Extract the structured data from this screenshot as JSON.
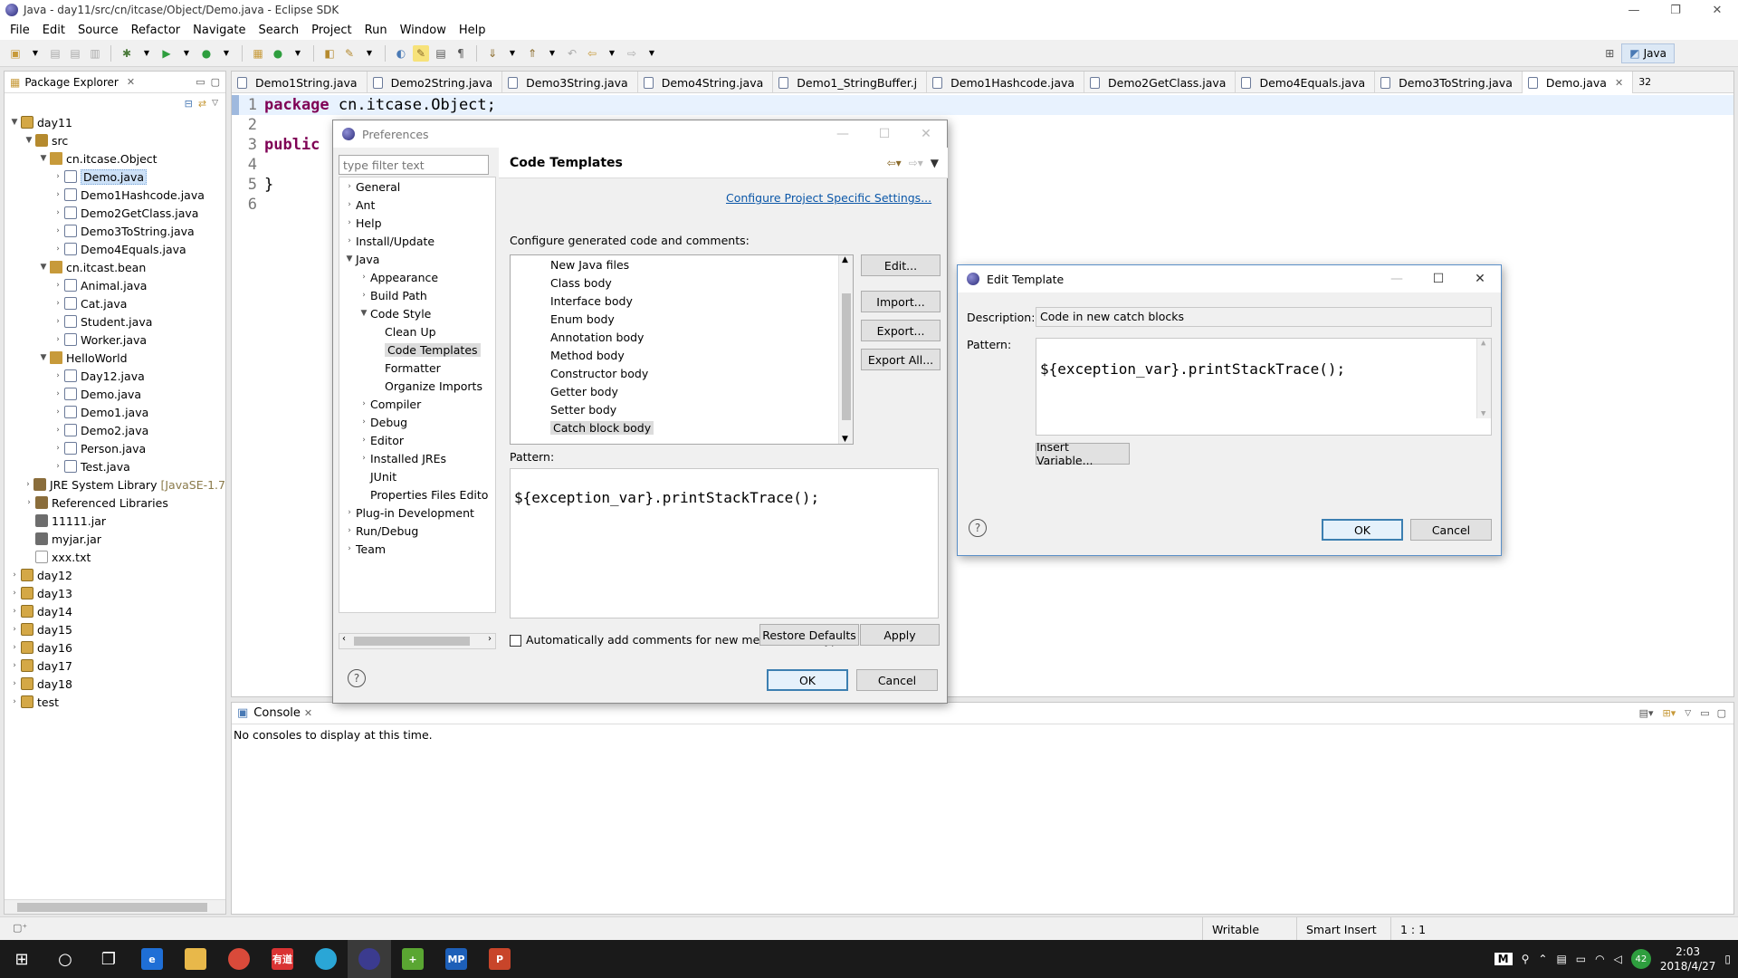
{
  "window": {
    "title": "Java - day11/src/cn/itcase/Object/Demo.java - Eclipse SDK",
    "minimize": "—",
    "restore": "❐",
    "close": "✕"
  },
  "menu": [
    "File",
    "Edit",
    "Source",
    "Refactor",
    "Navigate",
    "Search",
    "Project",
    "Run",
    "Window",
    "Help"
  ],
  "perspective": {
    "label": "Java"
  },
  "package_explorer": {
    "title": "Package Explorer",
    "tree": [
      {
        "label": "day11",
        "depth": 0,
        "icon": "proj",
        "twisty": "▼"
      },
      {
        "label": "src",
        "depth": 1,
        "icon": "src",
        "twisty": "▼"
      },
      {
        "label": "cn.itcase.Object",
        "depth": 2,
        "icon": "pkg",
        "twisty": "▼"
      },
      {
        "label": "Demo.java",
        "depth": 3,
        "icon": "java",
        "twisty": "›",
        "selected": true
      },
      {
        "label": "Demo1Hashcode.java",
        "depth": 3,
        "icon": "java",
        "twisty": "›"
      },
      {
        "label": "Demo2GetClass.java",
        "depth": 3,
        "icon": "java",
        "twisty": "›"
      },
      {
        "label": "Demo3ToString.java",
        "depth": 3,
        "icon": "java",
        "twisty": "›"
      },
      {
        "label": "Demo4Equals.java",
        "depth": 3,
        "icon": "java",
        "twisty": "›"
      },
      {
        "label": "cn.itcast.bean",
        "depth": 2,
        "icon": "pkg",
        "twisty": "▼"
      },
      {
        "label": "Animal.java",
        "depth": 3,
        "icon": "java",
        "twisty": "›"
      },
      {
        "label": "Cat.java",
        "depth": 3,
        "icon": "java",
        "twisty": "›"
      },
      {
        "label": "Student.java",
        "depth": 3,
        "icon": "java",
        "twisty": "›"
      },
      {
        "label": "Worker.java",
        "depth": 3,
        "icon": "java",
        "twisty": "›"
      },
      {
        "label": "HelloWorld",
        "depth": 2,
        "icon": "pkg",
        "twisty": "▼"
      },
      {
        "label": "Day12.java",
        "depth": 3,
        "icon": "java",
        "twisty": "›"
      },
      {
        "label": "Demo.java",
        "depth": 3,
        "icon": "java",
        "twisty": "›"
      },
      {
        "label": "Demo1.java",
        "depth": 3,
        "icon": "java",
        "twisty": "›"
      },
      {
        "label": "Demo2.java",
        "depth": 3,
        "icon": "java",
        "twisty": "›"
      },
      {
        "label": "Person.java",
        "depth": 3,
        "icon": "java",
        "twisty": "›"
      },
      {
        "label": "Test.java",
        "depth": 3,
        "icon": "java",
        "twisty": "›"
      },
      {
        "label": "JRE System Library",
        "extra": "[JavaSE-1.7",
        "depth": 1,
        "icon": "lib",
        "twisty": "›"
      },
      {
        "label": "Referenced Libraries",
        "depth": 1,
        "icon": "lib",
        "twisty": "›"
      },
      {
        "label": "11111.jar",
        "depth": 1,
        "icon": "jar",
        "twisty": ""
      },
      {
        "label": "myjar.jar",
        "depth": 1,
        "icon": "jar",
        "twisty": ""
      },
      {
        "label": "xxx.txt",
        "depth": 1,
        "icon": "txt",
        "twisty": ""
      },
      {
        "label": "day12",
        "depth": 0,
        "icon": "proj",
        "twisty": "›"
      },
      {
        "label": "day13",
        "depth": 0,
        "icon": "proj",
        "twisty": "›"
      },
      {
        "label": "day14",
        "depth": 0,
        "icon": "proj",
        "twisty": "›"
      },
      {
        "label": "day15",
        "depth": 0,
        "icon": "proj",
        "twisty": "›"
      },
      {
        "label": "day16",
        "depth": 0,
        "icon": "proj",
        "twisty": "›"
      },
      {
        "label": "day17",
        "depth": 0,
        "icon": "proj",
        "twisty": "›"
      },
      {
        "label": "day18",
        "depth": 0,
        "icon": "proj",
        "twisty": "›"
      },
      {
        "label": "test",
        "depth": 0,
        "icon": "proj",
        "twisty": "›"
      }
    ]
  },
  "editor": {
    "tabs": [
      {
        "label": "Demo1String.java"
      },
      {
        "label": "Demo2String.java"
      },
      {
        "label": "Demo3String.java"
      },
      {
        "label": "Demo4String.java"
      },
      {
        "label": "Demo1_StringBuffer.j"
      },
      {
        "label": "Demo1Hashcode.java"
      },
      {
        "label": "Demo2GetClass.java"
      },
      {
        "label": "Demo4Equals.java"
      },
      {
        "label": "Demo3ToString.java"
      },
      {
        "label": "Demo.java",
        "active": true
      }
    ],
    "overflow_count": "32",
    "lines": [
      {
        "n": "1",
        "kw": "package",
        "text": " cn.itcase.Object;",
        "current": true
      },
      {
        "n": "2",
        "kw": "",
        "text": ""
      },
      {
        "n": "3",
        "kw": "public",
        "text": ""
      },
      {
        "n": "4",
        "kw": "",
        "text": ""
      },
      {
        "n": "5",
        "kw": "",
        "text": "}"
      },
      {
        "n": "6",
        "kw": "",
        "text": ""
      }
    ]
  },
  "console": {
    "title": "Console",
    "message": "No consoles to display at this time."
  },
  "statusbar": {
    "mode": "Writable",
    "insert": "Smart Insert",
    "position": "1 : 1"
  },
  "preferences": {
    "title": "Preferences",
    "filter_placeholder": "type filter text",
    "tree": [
      {
        "label": "General",
        "depth": 0,
        "twisty": "›"
      },
      {
        "label": "Ant",
        "depth": 0,
        "twisty": "›"
      },
      {
        "label": "Help",
        "depth": 0,
        "twisty": "›"
      },
      {
        "label": "Install/Update",
        "depth": 0,
        "twisty": "›"
      },
      {
        "label": "Java",
        "depth": 0,
        "twisty": "▼"
      },
      {
        "label": "Appearance",
        "depth": 1,
        "twisty": "›"
      },
      {
        "label": "Build Path",
        "depth": 1,
        "twisty": "›"
      },
      {
        "label": "Code Style",
        "depth": 1,
        "twisty": "▼"
      },
      {
        "label": "Clean Up",
        "depth": 2,
        "twisty": ""
      },
      {
        "label": "Code Templates",
        "depth": 2,
        "twisty": "",
        "selected": true
      },
      {
        "label": "Formatter",
        "depth": 2,
        "twisty": ""
      },
      {
        "label": "Organize Imports",
        "depth": 2,
        "twisty": ""
      },
      {
        "label": "Compiler",
        "depth": 1,
        "twisty": "›"
      },
      {
        "label": "Debug",
        "depth": 1,
        "twisty": "›"
      },
      {
        "label": "Editor",
        "depth": 1,
        "twisty": "›"
      },
      {
        "label": "Installed JREs",
        "depth": 1,
        "twisty": "›"
      },
      {
        "label": "JUnit",
        "depth": 1,
        "twisty": ""
      },
      {
        "label": "Properties Files Edito",
        "depth": 1,
        "twisty": ""
      },
      {
        "label": "Plug-in Development",
        "depth": 0,
        "twisty": "›"
      },
      {
        "label": "Run/Debug",
        "depth": 0,
        "twisty": "›"
      },
      {
        "label": "Team",
        "depth": 0,
        "twisty": "›"
      }
    ],
    "page_title": "Code Templates",
    "project_settings_link": "Configure Project Specific Settings...",
    "configure_label": "Configure generated code and comments:",
    "templates": [
      {
        "label": "New Java files"
      },
      {
        "label": "Class body"
      },
      {
        "label": "Interface body"
      },
      {
        "label": "Enum body"
      },
      {
        "label": "Annotation body"
      },
      {
        "label": "Method body"
      },
      {
        "label": "Constructor body"
      },
      {
        "label": "Getter body"
      },
      {
        "label": "Setter body"
      },
      {
        "label": "Catch block body",
        "selected": true
      }
    ],
    "buttons": {
      "edit": "Edit...",
      "import": "Import...",
      "export": "Export...",
      "export_all": "Export All...",
      "restore": "Restore Defaults",
      "apply": "Apply",
      "ok": "OK",
      "cancel": "Cancel"
    },
    "pattern_label": "Pattern:",
    "pattern": "${exception_var}.printStackTrace();",
    "auto_comments_label": "Automatically add comments for new methods and types",
    "help": "?"
  },
  "edit_template": {
    "title": "Edit Template",
    "description_label": "Description:",
    "description": "Code in new catch blocks",
    "pattern_label": "Pattern:",
    "pattern": "${exception_var}.printStackTrace();",
    "insert_variable": "Insert Variable...",
    "ok": "OK",
    "cancel": "Cancel",
    "help": "?"
  },
  "taskbar": {
    "items": [
      {
        "name": "start-icon",
        "glyph": "⊞",
        "color": ""
      },
      {
        "name": "cortana-icon",
        "glyph": "○",
        "color": ""
      },
      {
        "name": "task-view-icon",
        "glyph": "❐",
        "color": ""
      },
      {
        "name": "edge-icon",
        "glyph": "e",
        "color": "#1f6fd6"
      },
      {
        "name": "file-explorer-icon",
        "glyph": "",
        "color": "#e8b84a"
      },
      {
        "name": "chrome-icon",
        "glyph": "",
        "color": "#d94a3a"
      },
      {
        "name": "youdao-icon",
        "glyph": "有道",
        "color": "#d93333"
      },
      {
        "name": "qq-browser-icon",
        "glyph": "",
        "color": "#2aa6d6"
      },
      {
        "name": "eclipse-icon",
        "glyph": "",
        "color": "#3b3b8f"
      },
      {
        "name": "plus-app-icon",
        "glyph": "+",
        "color": "#5aa632"
      },
      {
        "name": "mp-app-icon",
        "glyph": "MP",
        "color": "#1d5fb8"
      },
      {
        "name": "powerpoint-icon",
        "glyph": "P",
        "color": "#c8452a"
      }
    ],
    "tray_ime": "M",
    "tray_badge": "42",
    "time": "2:03",
    "date": "2018/4/27"
  }
}
